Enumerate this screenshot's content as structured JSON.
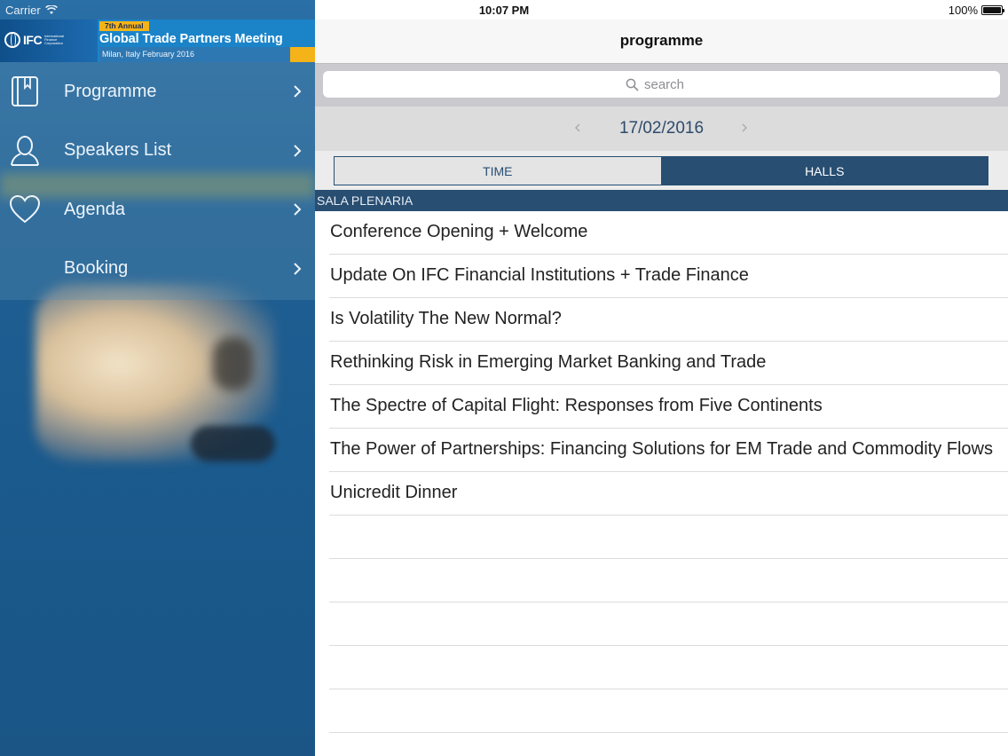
{
  "status_bar": {
    "carrier": "Carrier",
    "time": "10:07 PM",
    "battery": "100%"
  },
  "banner": {
    "logo_text": "IFC",
    "logo_sub": "International Finance Corporation",
    "annual": "7th Annual",
    "title": "Global Trade Partners Meeting",
    "subtitle": "Milan, Italy February 2016"
  },
  "sidebar": {
    "items": [
      {
        "label": "Programme",
        "icon": "book-icon"
      },
      {
        "label": "Speakers List",
        "icon": "person-icon"
      },
      {
        "label": "Agenda",
        "icon": "heart-icon"
      },
      {
        "label": "Booking",
        "icon": ""
      }
    ]
  },
  "navbar": {
    "title": "programme"
  },
  "search": {
    "placeholder": "search"
  },
  "date_nav": {
    "date": "17/02/2016"
  },
  "segment": {
    "time_label": "TIME",
    "halls_label": "HALLS",
    "selected": "HALLS"
  },
  "section": {
    "header": "SALA PLENARIA"
  },
  "sessions": [
    "Conference Opening + Welcome",
    "Update On IFC Financial Institutions + Trade Finance",
    "Is Volatility The New Normal?",
    "Rethinking Risk in Emerging Market Banking and Trade",
    "The Spectre of Capital Flight: Responses from Five Continents",
    "The Power of Partnerships: Financing Solutions for EM Trade and Commodity Flows",
    "Unicredit Dinner"
  ],
  "colors": {
    "accent": "#284e72",
    "sidebar": "#1f5f93",
    "banner_yellow": "#f4b318"
  }
}
